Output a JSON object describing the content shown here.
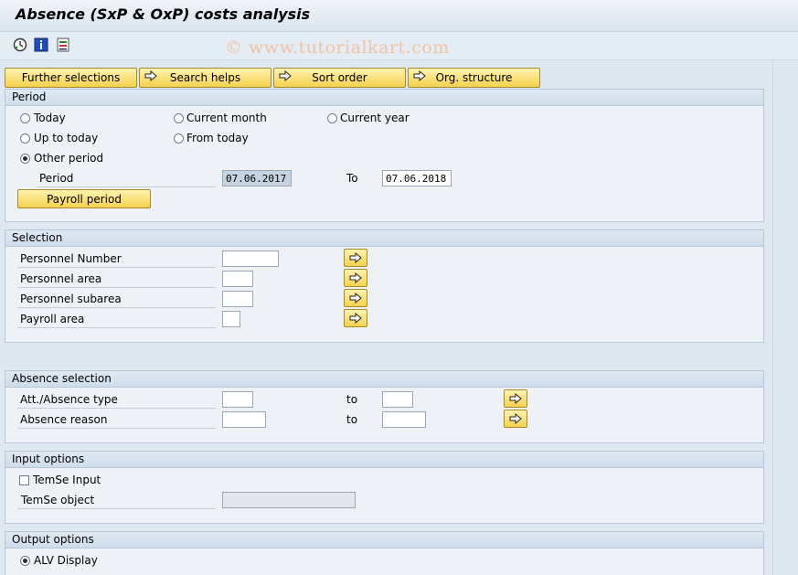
{
  "window": {
    "title": "Absence (SxP & OxP) costs analysis"
  },
  "toolbar": {
    "watermark": "© www.tutorialkart.com",
    "icons": [
      "execute-icon",
      "info-icon",
      "variant-icon"
    ]
  },
  "top_buttons": {
    "further": "Further selections",
    "search": "Search helps",
    "sort": "Sort order",
    "org": "Org. structure"
  },
  "period": {
    "header": "Period",
    "today": "Today",
    "current_month": "Current month",
    "current_year": "Current year",
    "up_to_today": "Up to today",
    "from_today": "From today",
    "other_period": "Other period",
    "selected": "other_period",
    "period_label": "Period",
    "from_value": "07.06.2017",
    "to_label": "To",
    "to_value": "07.06.2018",
    "payroll_button": "Payroll period"
  },
  "selection": {
    "header": "Selection",
    "rows": [
      {
        "label": "Personnel Number",
        "value": ""
      },
      {
        "label": "Personnel area",
        "value": ""
      },
      {
        "label": "Personnel subarea",
        "value": ""
      },
      {
        "label": "Payroll area",
        "value": ""
      }
    ]
  },
  "absence_selection": {
    "header": "Absence selection",
    "rows": [
      {
        "label": "Att./Absence type",
        "from": "",
        "to_label": "to",
        "to": ""
      },
      {
        "label": "Absence reason",
        "from": "",
        "to_label": "to",
        "to": ""
      }
    ]
  },
  "input_options": {
    "header": "Input options",
    "temse_input": "TemSe Input",
    "temse_input_checked": false,
    "temse_object_label": "TemSe object",
    "temse_object_value": ""
  },
  "output_options": {
    "header": "Output options",
    "alv_display": "ALV Display",
    "alv_selected": true
  },
  "colors": {
    "button_yellow": "#f5d14e",
    "background": "#dfe8f1",
    "watermark": "#f2c2a4"
  }
}
